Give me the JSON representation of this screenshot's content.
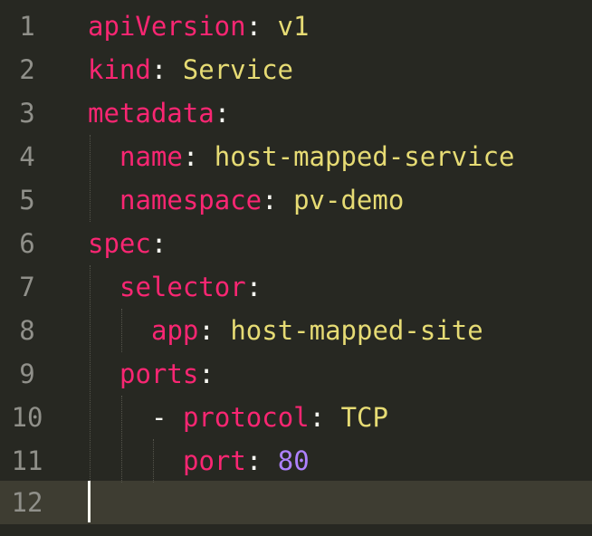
{
  "editor": {
    "lines": [
      {
        "number": "1",
        "key": "apiVersion",
        "colon": ":",
        "value": "v1"
      },
      {
        "number": "2",
        "key": "kind",
        "colon": ":",
        "value": "Service"
      },
      {
        "number": "3",
        "key": "metadata",
        "colon": ":",
        "value": ""
      },
      {
        "number": "4",
        "key": "name",
        "colon": ":",
        "value": "host-mapped-service"
      },
      {
        "number": "5",
        "key": "namespace",
        "colon": ":",
        "value": "pv-demo"
      },
      {
        "number": "6",
        "key": "spec",
        "colon": ":",
        "value": ""
      },
      {
        "number": "7",
        "key": "selector",
        "colon": ":",
        "value": ""
      },
      {
        "number": "8",
        "key": "app",
        "colon": ":",
        "value": "host-mapped-site"
      },
      {
        "number": "9",
        "key": "ports",
        "colon": ":",
        "value": ""
      },
      {
        "number": "10",
        "dash": "-",
        "key": "protocol",
        "colon": ":",
        "value": "TCP"
      },
      {
        "number": "11",
        "key": "port",
        "colon": ":",
        "value": "80"
      },
      {
        "number": "12",
        "key": "",
        "colon": "",
        "value": ""
      }
    ],
    "current_line": "12"
  },
  "theme": {
    "background": "#272822",
    "current_line_background": "#3e3d32",
    "key_color": "#f92672",
    "string_color": "#e6db74",
    "number_color": "#ae81ff",
    "gutter_color": "#90908a"
  }
}
